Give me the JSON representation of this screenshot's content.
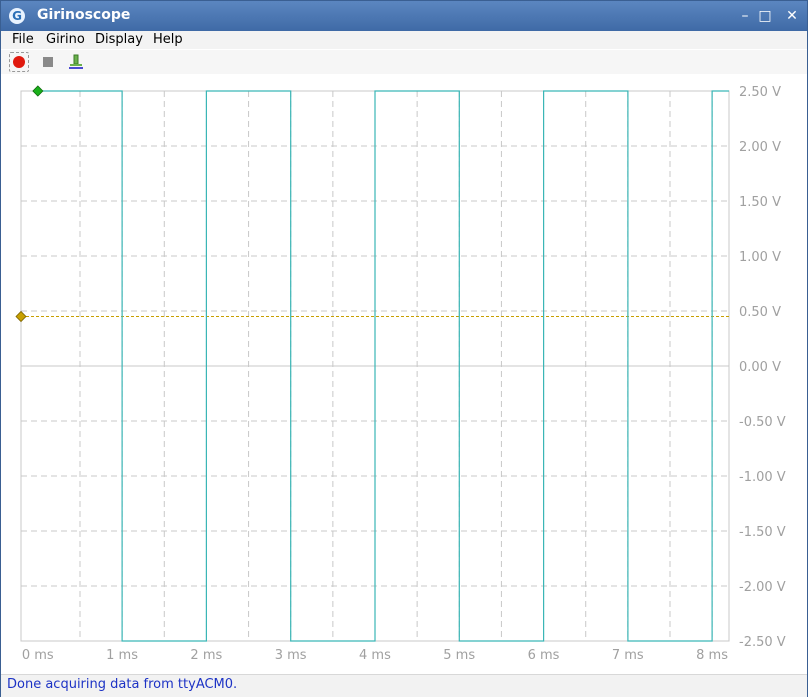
{
  "window": {
    "title": "Girinoscope",
    "icon_name": "girinoscope-app-icon"
  },
  "window_controls": {
    "minimize": "–",
    "maximize": "□",
    "close": "✕"
  },
  "menu": [
    "File",
    "Girino",
    "Display",
    "Help"
  ],
  "toolbar": {
    "buttons": [
      {
        "name": "record-button",
        "icon": "record-icon",
        "active": true
      },
      {
        "name": "stop-button",
        "icon": "stop-icon",
        "active": false
      },
      {
        "name": "sample-button",
        "icon": "probe-icon",
        "active": false
      }
    ]
  },
  "scope": {
    "trace_color": "#3ab6b6",
    "threshold_color": "#c8a000",
    "trigger_marker_color": "#1ab01a",
    "threshold_marker_color": "#c8a000",
    "x_labels": [
      "0 ms",
      "1 ms",
      "2 ms",
      "3 ms",
      "4 ms",
      "5 ms",
      "6 ms",
      "7 ms",
      "8 ms"
    ],
    "y_labels": [
      "2.50 V",
      "2.00 V",
      "1.50 V",
      "1.00 V",
      "0.50 V",
      "0.00 V",
      "-0.50 V",
      "-1.00 V",
      "-1.50 V",
      "-2.00 V",
      "-2.50 V"
    ]
  },
  "chart_data": {
    "type": "line",
    "xlabel": "",
    "ylabel": "",
    "xlim": [
      -0.2,
      8.2
    ],
    "ylim": [
      -2.5,
      2.5
    ],
    "grid": true,
    "threshold_v": 0.45,
    "trigger_ms": 0.0,
    "series": [
      {
        "x": [
          0.0,
          1.0,
          1.0,
          2.0,
          2.0,
          3.0,
          3.0,
          4.0,
          4.0,
          5.0,
          5.0,
          6.0,
          6.0,
          7.0,
          7.0,
          8.0,
          8.0,
          8.2
        ],
        "y": [
          2.5,
          2.5,
          -2.5,
          -2.5,
          2.5,
          2.5,
          -2.5,
          -2.5,
          2.5,
          2.5,
          -2.5,
          -2.5,
          2.5,
          2.5,
          -2.5,
          -2.5,
          2.5,
          2.5
        ]
      }
    ]
  },
  "status": "Done acquiring data from ttyACM0."
}
